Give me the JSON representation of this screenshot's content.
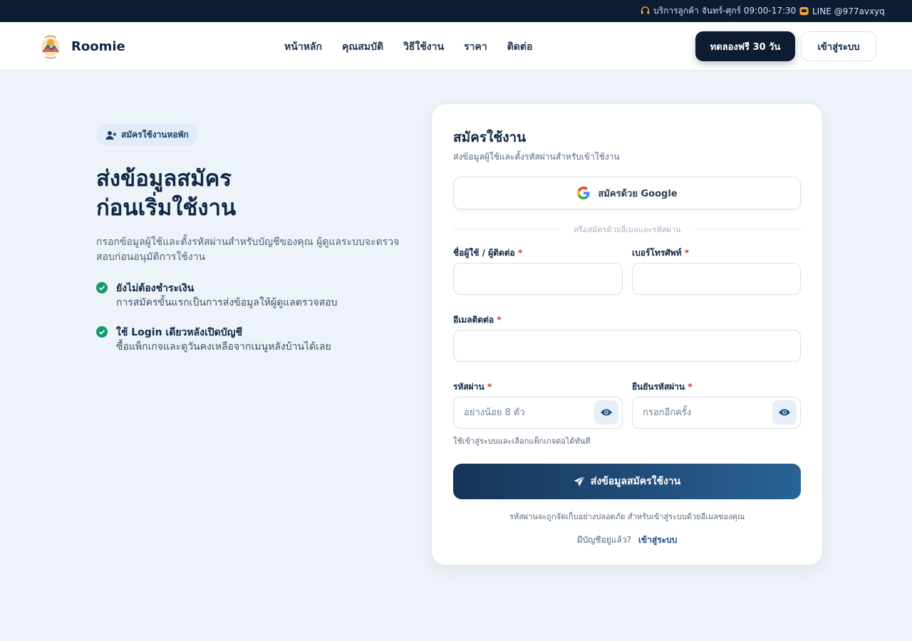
{
  "topbar": {
    "support_text": "บริการลูกค้า จันทร์-ศุกร์ 09:00-17:30",
    "line_text": "LINE @977avxyq"
  },
  "nav": {
    "brand": "Roomie",
    "links": [
      "หน้าหลัก",
      "คุณสมบัติ",
      "วิธีใช้งาน",
      "ราคา",
      "ติดต่อ"
    ],
    "trial_button": "ทดลองฟรี 30 วัน",
    "login_button": "เข้าสู่ระบบ"
  },
  "hero": {
    "badge": "สมัครใช้งานหอพัก",
    "title_line1": "ส่งข้อมูลสมัคร",
    "title_line2": "ก่อนเริ่มใช้งาน",
    "description": "กรอกข้อมูลผู้ใช้และตั้งรหัสผ่านสำหรับบัญชีของคุณ ผู้ดูแลระบบจะตรวจสอบก่อนอนุมัติการใช้งาน",
    "features": [
      {
        "title": "ยังไม่ต้องชำระเงิน",
        "desc": "การสมัครขั้นแรกเป็นการส่งข้อมูลให้ผู้ดูแลตรวจสอบ"
      },
      {
        "title": "ใช้ Login เดียวหลังเปิดบัญชี",
        "desc": "ซื้อแพ็กเกจและดูวันคงเหลือจากเมนูหลังบ้านได้เลย"
      }
    ]
  },
  "form": {
    "title": "สมัครใช้งาน",
    "subtitle": "ส่งข้อมูลผู้ใช้และตั้งรหัสผ่านสำหรับเข้าใช้งาน",
    "google_button": "สมัครด้วย Google",
    "divider_text": "หรือสมัครด้วยอีเมลและรหัสผ่าน",
    "name_label": "ชื่อผู้ใช้ / ผู้ติดต่อ",
    "phone_label": "เบอร์โทรศัพท์",
    "email_label": "อีเมลติดต่อ",
    "password_label": "รหัสผ่าน",
    "password_placeholder": "อย่างน้อย 8 ตัว",
    "confirm_label": "ยืนยันรหัสผ่าน",
    "confirm_placeholder": "กรอกอีกครั้ง",
    "required_mark": "*",
    "hint": "ใช้เข้าสู่ระบบและเลือกแพ็กเกจต่อได้ทันที",
    "submit_button": "ส่งข้อมูลสมัครใช้งาน",
    "note": "รหัสผ่านจะถูกจัดเก็บอย่างปลอดภัย สำหรับเข้าสู่ระบบด้วยอีเมลของคุณ",
    "have_account": "มีบัญชีอยู่แล้ว?",
    "login_link": "เข้าสู่ระบบ"
  },
  "colors": {
    "navy": "#0d1c33",
    "accent_blue": "#2a6396",
    "check_green": "#0f9a6c",
    "required_red": "#d63232",
    "page_bg": "#eef3f9"
  }
}
